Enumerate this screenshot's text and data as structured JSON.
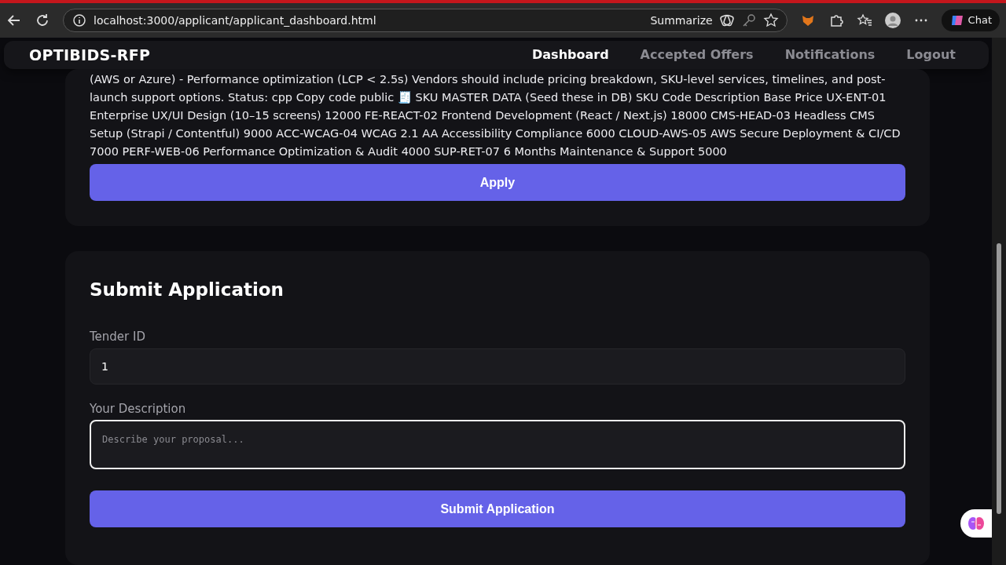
{
  "browser": {
    "url": "localhost:3000/applicant/applicant_dashboard.html",
    "summarize_label": "Summarize",
    "chat_label": "Chat"
  },
  "navbar": {
    "brand": "OPTIBIDS-RFP",
    "links": [
      {
        "label": "Dashboard",
        "selected": true
      },
      {
        "label": "Accepted Offers",
        "selected": false
      },
      {
        "label": "Notifications",
        "selected": false
      },
      {
        "label": "Logout",
        "selected": false
      }
    ]
  },
  "tender": {
    "description": "(AWS or Azure) - Performance optimization (LCP < 2.5s) Vendors should include pricing breakdown, SKU-level services, timelines, and post-launch support options. Status: cpp Copy code public 🧾 SKU MASTER DATA (Seed these in DB) SKU Code Description Base Price UX-ENT-01 Enterprise UX/UI Design (10–15 screens) 12000 FE-REACT-02 Frontend Development (React / Next.js) 18000 CMS-HEAD-03 Headless CMS Setup (Strapi / Contentful) 9000 ACC-WCAG-04 WCAG 2.1 AA Accessibility Compliance 6000 CLOUD-AWS-05 AWS Secure Deployment & CI/CD 7000 PERF-WEB-06 Performance Optimization & Audit 4000 SUP-RET-07 6 Months Maintenance & Support 5000",
    "apply_label": "Apply"
  },
  "form": {
    "title": "Submit Application",
    "fields": [
      {
        "kind": "input",
        "label": "Tender ID",
        "value": "1",
        "focused": false
      },
      {
        "kind": "textarea",
        "label": "Your Description",
        "placeholder": "Describe your proposal...",
        "focused": true
      }
    ],
    "submit_label": "Submit Application"
  }
}
